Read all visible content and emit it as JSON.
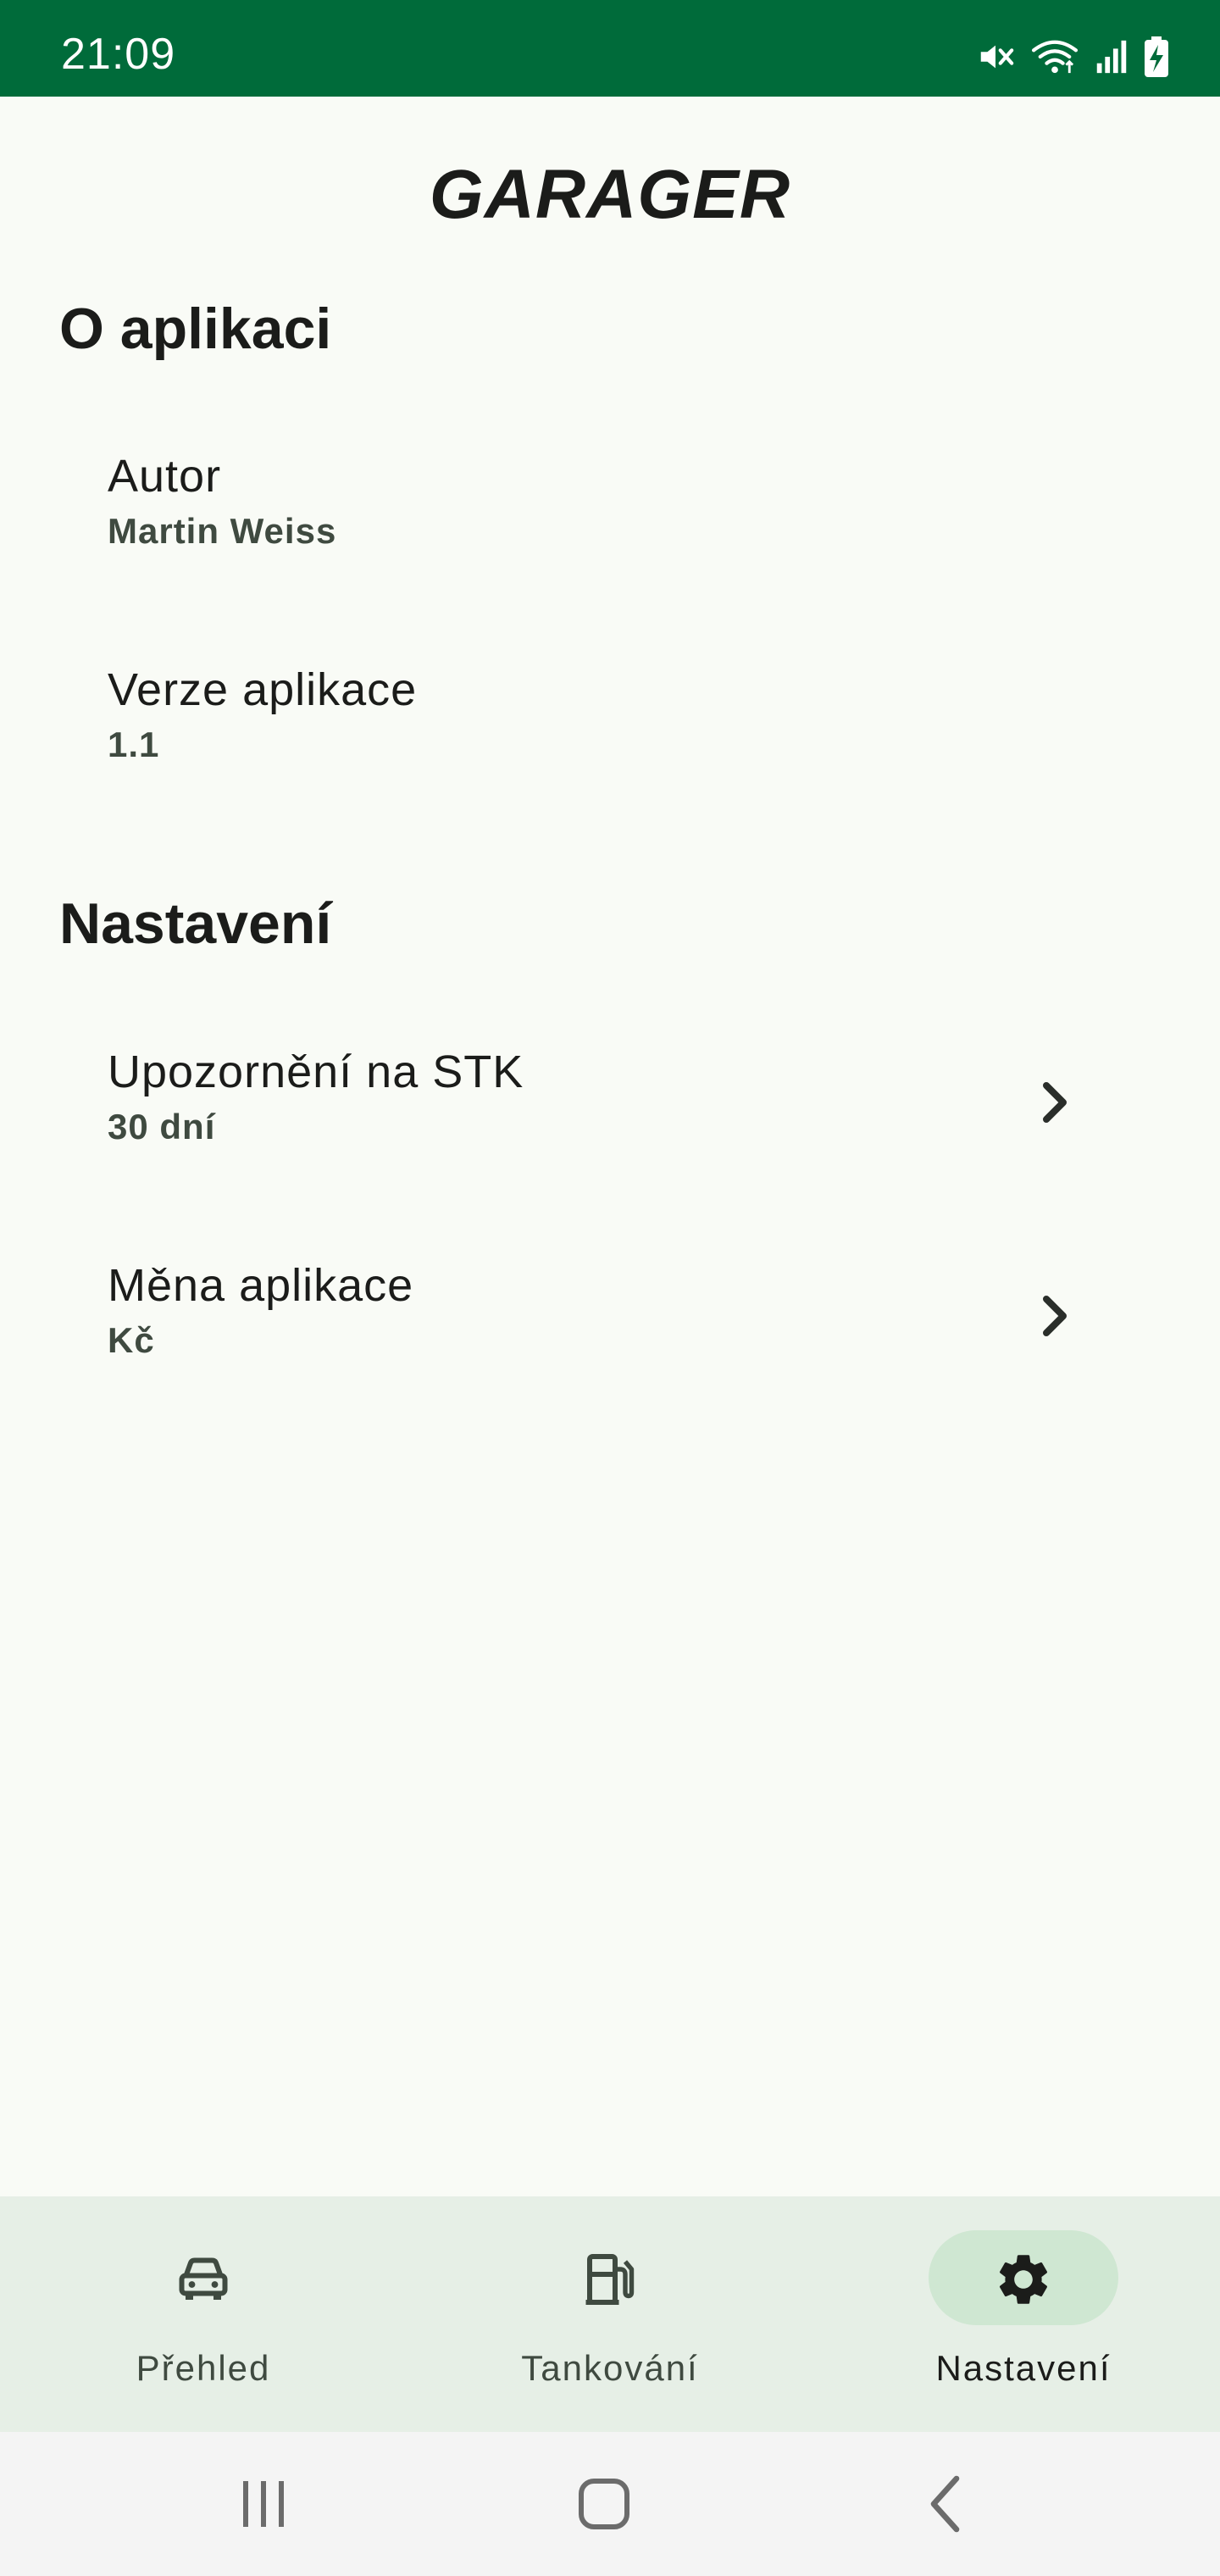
{
  "status_bar": {
    "time": "21:09",
    "icons": [
      "mute-icon",
      "wifi-icon",
      "signal-icon",
      "battery-charging-icon"
    ]
  },
  "app": {
    "title": "GARAGER"
  },
  "about": {
    "heading": "O aplikaci",
    "author_label": "Autor",
    "author_value": "Martin Weiss",
    "version_label": "Verze aplikace",
    "version_value": "1.1"
  },
  "settings": {
    "heading": "Nastavení",
    "stk_label": "Upozornění na STK",
    "stk_value": "30 dní",
    "currency_label": "Měna aplikace",
    "currency_value": "Kč"
  },
  "bottom_nav": {
    "items": [
      {
        "label": "Přehled",
        "icon": "car-icon",
        "active": false
      },
      {
        "label": "Tankování",
        "icon": "fuel-pump-icon",
        "active": false
      },
      {
        "label": "Nastavení",
        "icon": "gear-icon",
        "active": true
      }
    ]
  },
  "colors": {
    "status_bar": "#006b3a",
    "background": "#f9fbf6",
    "nav_background": "#e6efe6",
    "nav_active_pill": "#cfe7d2"
  }
}
